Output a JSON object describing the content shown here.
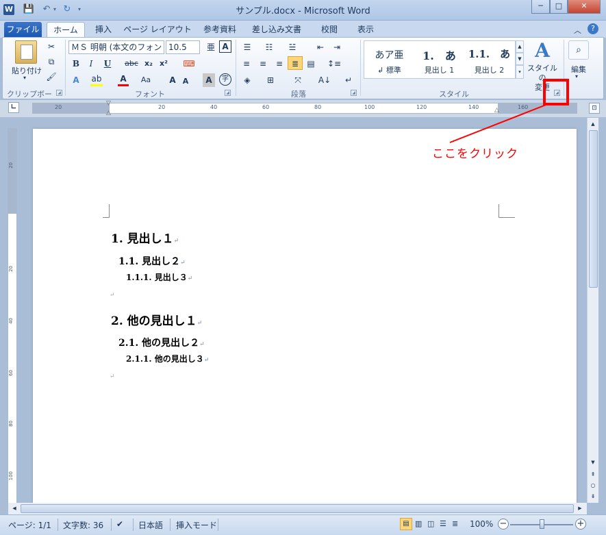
{
  "window": {
    "title": "サンプル.docx - Microsoft Word",
    "app_icon": "W",
    "controls": {
      "minimize": "─",
      "maximize": "□",
      "close": "✕"
    }
  },
  "tabs": [
    {
      "label": "ファイル"
    },
    {
      "label": "ホーム"
    },
    {
      "label": "挿入"
    },
    {
      "label": "ページ レイアウト"
    },
    {
      "label": "参考資料"
    },
    {
      "label": "差し込み文書"
    },
    {
      "label": "校閲"
    },
    {
      "label": "表示"
    }
  ],
  "ribbon": {
    "clipboard": {
      "paste_label": "貼り付け",
      "group_label": "クリップボード"
    },
    "font": {
      "font_name": "ＭＳ 明朝 (本文のフォン",
      "font_size": "10.5",
      "bold": "B",
      "italic": "I",
      "underline": "U",
      "strike": "abc",
      "subscript": "x₂",
      "superscript": "x²",
      "case": "Aa",
      "grow": "A",
      "shrink": "A",
      "clear": "A",
      "phonetic": "亜",
      "enclose": "字",
      "group_label": "フォント"
    },
    "paragraph": {
      "group_label": "段落"
    },
    "styles": {
      "items": [
        {
          "sample": "あア亜",
          "name": "↲ 標準"
        },
        {
          "sample": "1.　あ",
          "name": "見出し 1"
        },
        {
          "sample": "1.1.　あ",
          "name": "見出し 2"
        }
      ],
      "change_styles_label": "スタイルの\n変更",
      "group_label": "スタイル"
    },
    "editing": {
      "label": "編集"
    }
  },
  "ruler": {
    "ticks": [
      "20",
      "20",
      "40",
      "60",
      "80",
      "100",
      "120",
      "140",
      "160"
    ]
  },
  "vruler": {
    "ticks": [
      "20",
      "20",
      "40",
      "60",
      "80",
      "100"
    ]
  },
  "document": {
    "lines": [
      {
        "text": "1. 見出し１"
      },
      {
        "text": "1.1. 見出し２"
      },
      {
        "text": "1.1.1. 見出し３"
      },
      {
        "text": ""
      },
      {
        "text": "2. 他の見出し１"
      },
      {
        "text": "2.1. 他の見出し２"
      },
      {
        "text": "2.1.1. 他の見出し３"
      },
      {
        "text": ""
      }
    ],
    "para_mark": "↵"
  },
  "status": {
    "page": "ページ: 1/1",
    "words": "文字数: 36",
    "language": "日本語",
    "mode": "挿入モード",
    "zoom": "100%"
  },
  "annotation": {
    "text": "ここをクリック",
    "color": "#ff0000"
  }
}
